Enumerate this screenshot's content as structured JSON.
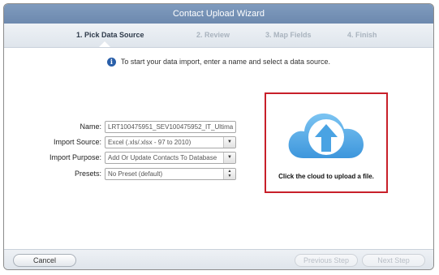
{
  "window": {
    "title": "Contact Upload Wizard"
  },
  "steps": [
    {
      "label": "1. Pick Data Source",
      "active": true
    },
    {
      "label": "2. Review",
      "active": false
    },
    {
      "label": "3. Map Fields",
      "active": false
    },
    {
      "label": "4. Finish",
      "active": false
    }
  ],
  "info": {
    "icon": "info-icon",
    "text": "To start your data import, enter a name and select a data source."
  },
  "form": {
    "name": {
      "label": "Name:",
      "value": "LRT100475951_SEV100475952_IT_Ultima"
    },
    "import_source": {
      "label": "Import Source:",
      "value": "Excel (.xls/.xlsx - 97 to 2010)"
    },
    "import_purpose": {
      "label": "Import Purpose:",
      "value": "Add Or Update Contacts To Database"
    },
    "presets": {
      "label": "Presets:",
      "value": "No Preset (default)"
    }
  },
  "upload": {
    "text": "Click the cloud to upload a file.",
    "highlight_color": "#c8202a",
    "cloud_color": "#5aaee8"
  },
  "footer": {
    "cancel": "Cancel",
    "previous": "Previous Step",
    "next": "Next Step"
  }
}
